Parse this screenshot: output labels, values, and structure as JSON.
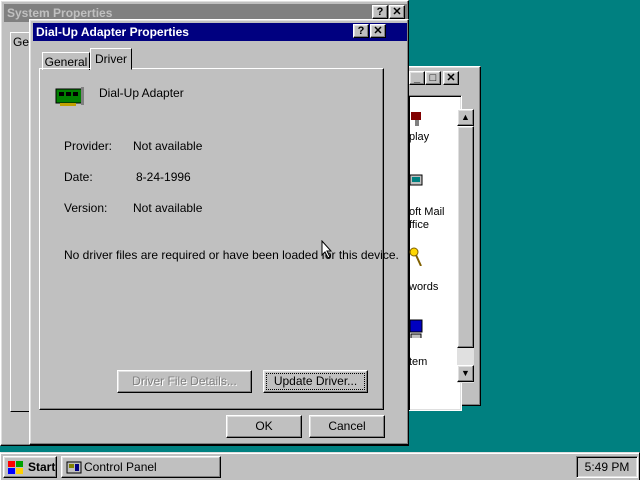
{
  "control_panel": {
    "items": [
      {
        "icon": "display-icon",
        "lines": [
          "play"
        ]
      },
      {
        "icon": "mail-icon",
        "lines": [
          "oft Mail",
          "ffice"
        ]
      },
      {
        "icon": "passwords-icon",
        "lines": [
          "words"
        ]
      },
      {
        "icon": "system-icon",
        "lines": [
          "tem"
        ]
      }
    ]
  },
  "system_properties": {
    "title": "System Properties",
    "tab_partial": "Ge"
  },
  "dialog": {
    "title": "Dial-Up Adapter Properties",
    "tabs": [
      "General",
      "Driver"
    ],
    "active_tab": "Driver",
    "device_name": "Dial-Up Adapter",
    "provider_label": "Provider:",
    "provider_value": "Not available",
    "date_label": "Date:",
    "date_value": "8-24-1996",
    "version_label": "Version:",
    "version_value": "Not available",
    "message": "No driver files are required or have been loaded for this device.",
    "driver_details_button": "Driver File Details...",
    "update_driver_button": "Update Driver...",
    "ok_button": "OK",
    "cancel_button": "Cancel"
  },
  "taskbar": {
    "start_label": "Start",
    "task_label": "Control Panel",
    "clock": "5:49 PM"
  }
}
